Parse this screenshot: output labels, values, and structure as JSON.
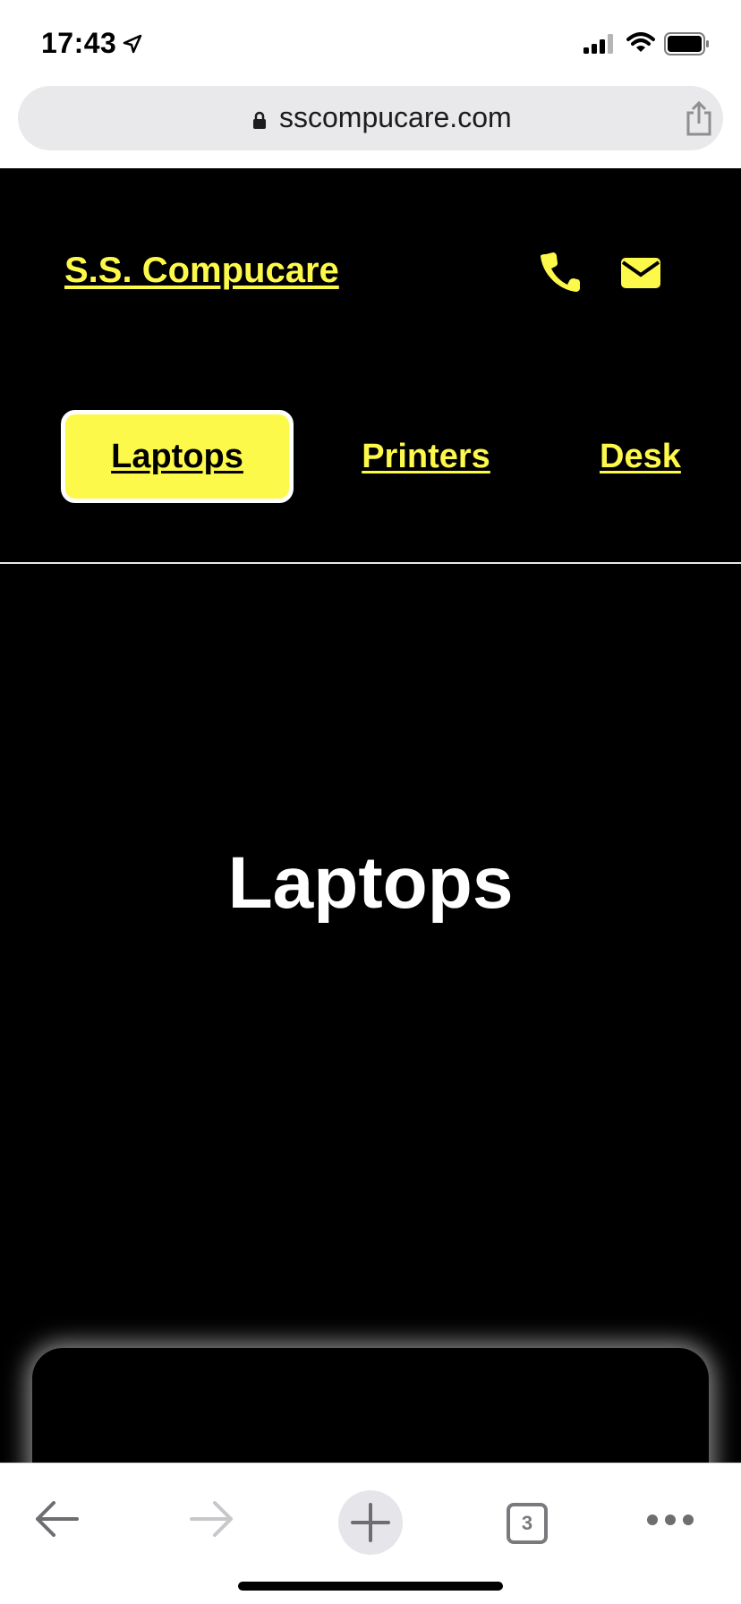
{
  "status_bar": {
    "time": "17:43"
  },
  "browser": {
    "url": "sscompucare.com",
    "open_tabs": "3"
  },
  "site": {
    "brand": "S.S. Compucare",
    "nav": [
      {
        "label": "Laptops",
        "active": true
      },
      {
        "label": "Printers",
        "active": false
      },
      {
        "label": "Desk",
        "active": false
      }
    ],
    "page_title": "Laptops"
  },
  "colors": {
    "accent_yellow": "#fdf94a",
    "background": "#000000",
    "text": "#ffffff"
  },
  "icons": [
    "location-arrow-icon",
    "signal-icon",
    "wifi-icon",
    "battery-icon",
    "lock-icon",
    "share-icon",
    "phone-icon",
    "mail-icon",
    "back-arrow-icon",
    "forward-arrow-icon",
    "plus-icon",
    "more-icon"
  ]
}
